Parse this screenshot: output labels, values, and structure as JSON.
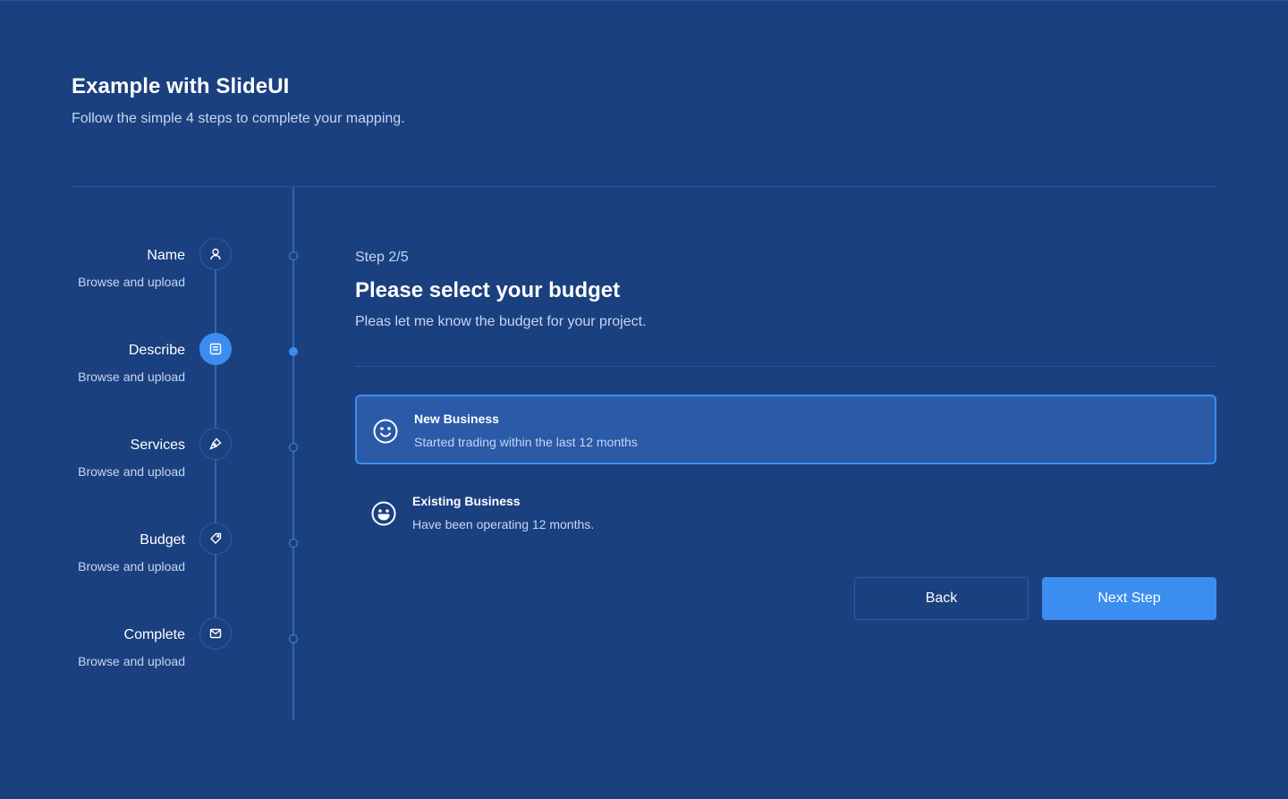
{
  "header": {
    "title": "Example with SlideUI",
    "subtitle": "Follow the simple 4 steps to complete your mapping."
  },
  "steps": [
    {
      "name": "Name",
      "desc": "Browse and upload",
      "icon": "user-icon",
      "active": false
    },
    {
      "name": "Describe",
      "desc": "Browse and upload",
      "icon": "document-icon",
      "active": true
    },
    {
      "name": "Services",
      "desc": "Browse and upload",
      "icon": "pen-tool-icon",
      "active": false
    },
    {
      "name": "Budget",
      "desc": "Browse and upload",
      "icon": "tag-icon",
      "active": false
    },
    {
      "name": "Complete",
      "desc": "Browse and upload",
      "icon": "mail-icon",
      "active": false
    }
  ],
  "form": {
    "step_count": "Step 2/5",
    "title": "Please select your budget",
    "subtitle": "Pleas let me know the budget for your project."
  },
  "options": [
    {
      "title": "New Business",
      "desc": "Started trading within the last 12 months",
      "icon": "smile-icon",
      "selected": true
    },
    {
      "title": "Existing Business",
      "desc": "Have been operating 12 months.",
      "icon": "laugh-icon",
      "selected": false
    }
  ],
  "buttons": {
    "back": "Back",
    "next": "Next Step"
  },
  "colors": {
    "background": "#1b4080",
    "accent": "#3b8ef0",
    "selected_bg": "#2a5aa8",
    "muted_text": "#c6d6f1"
  }
}
